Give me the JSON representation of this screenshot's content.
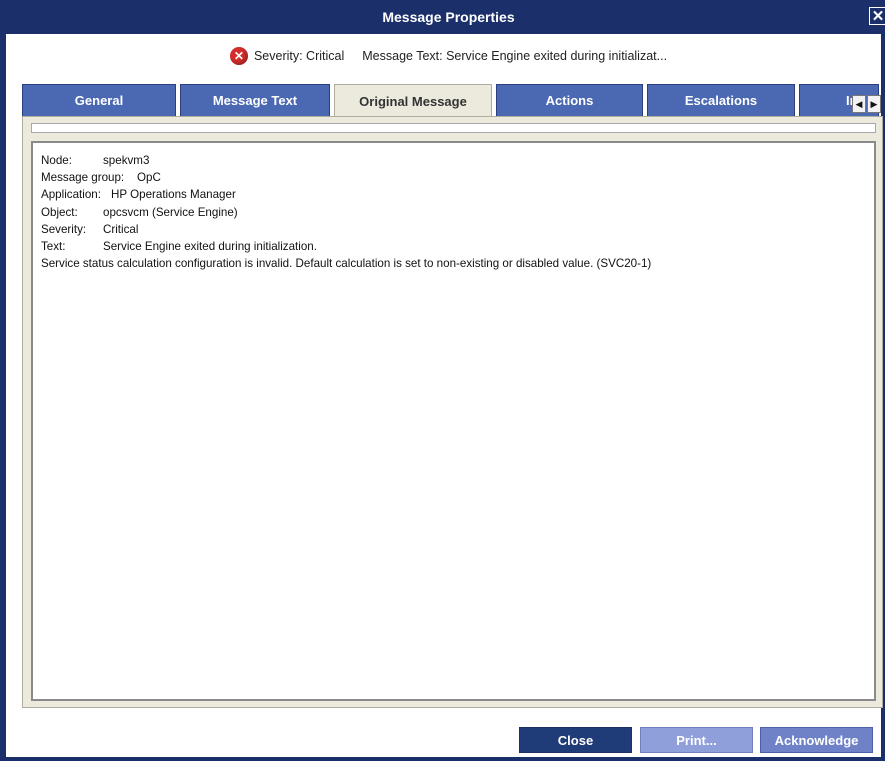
{
  "window": {
    "title": "Message Properties"
  },
  "summary": {
    "severity_text": "Severity: Critical",
    "message_text": "Message Text: Service Engine exited during initializat..."
  },
  "tabs": [
    {
      "label": "General"
    },
    {
      "label": "Message Text"
    },
    {
      "label": "Original Message"
    },
    {
      "label": "Actions"
    },
    {
      "label": "Escalations"
    },
    {
      "label": "In"
    }
  ],
  "original_message": {
    "node_label": "Node:",
    "node_value": "spekvm3",
    "group_label": "Message group:",
    "group_value": "OpC",
    "app_label": "Application:",
    "app_value": "HP Operations Manager",
    "object_label": "Object:",
    "object_value": "opcsvcm (Service Engine)",
    "severity_label": "Severity:",
    "severity_value": "Critical",
    "text_label": "Text:",
    "text_value": "Service Engine exited during initialization.",
    "detail_line": "Service status calculation configuration is invalid. Default calculation is set to non-existing or disabled value.  (SVC20-1)"
  },
  "buttons": {
    "close_label": "Close",
    "print_label": "Print...",
    "ack_label": "Acknowledge"
  },
  "colors": {
    "titlebar": "#1b2f6b",
    "tab": "#4b68b3",
    "active_tab": "#ece9dd",
    "button_dark": "#1f3c78",
    "button_light": "#8e9fd9",
    "severity_critical": "#d42d2d"
  },
  "icons": {
    "close": "close-x-icon",
    "severity": "critical-error-icon",
    "scroll_left": "arrow-left-icon",
    "scroll_right": "arrow-right-icon"
  }
}
